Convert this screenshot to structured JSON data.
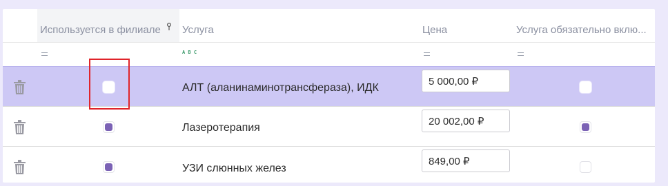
{
  "columns": {
    "used_in_branch": "Используется в филиале",
    "service": "Услуга",
    "price": "Цена",
    "mandatory": "Услуга обязательно вклю..."
  },
  "filter_row": {
    "service_filter_icon": "abc-text-filter-icon",
    "numeric_filter_icon": "equals-filter-icon"
  },
  "rows": [
    {
      "used_in_branch": false,
      "service": "АЛТ (аланинаминотрансфераза), ИДК",
      "price": "5 000,00 ₽",
      "mandatory": false,
      "selected": true
    },
    {
      "used_in_branch": true,
      "service": "Лазеротерапия",
      "price": "20 002,00 ₽",
      "mandatory": true,
      "selected": false
    },
    {
      "used_in_branch": true,
      "service": "УЗИ слюнных желез",
      "price": "849,00 ₽",
      "mandatory": false,
      "selected": false
    }
  ],
  "colors": {
    "selected_row": "#cdc8f5",
    "checkbox_checked": "#7b62b5",
    "highlight": "#e0242a"
  }
}
